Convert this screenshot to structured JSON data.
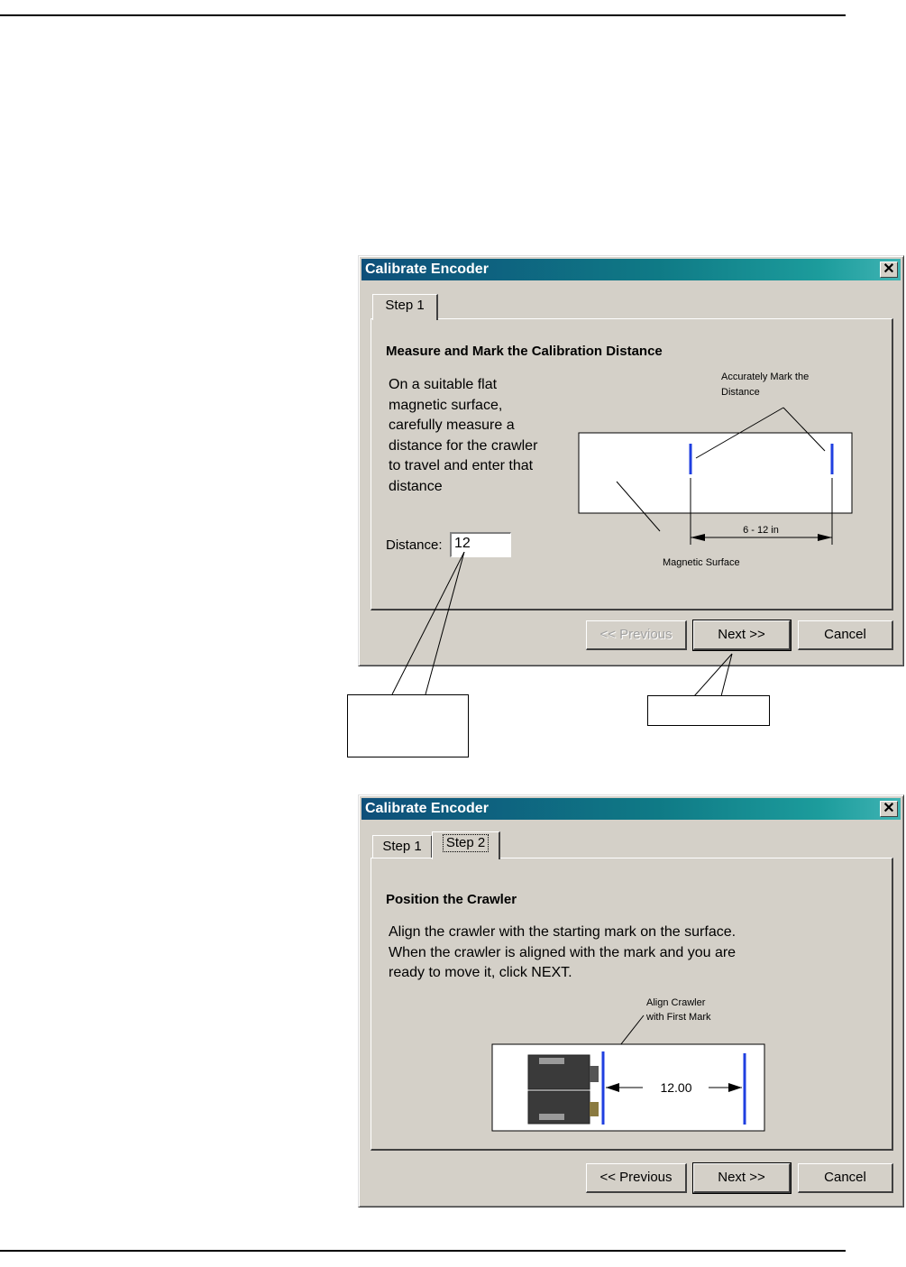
{
  "dialog1": {
    "title": "Calibrate Encoder",
    "close_glyph": "✕",
    "tabs": [
      {
        "label": "Step 1"
      }
    ],
    "heading": "Measure and Mark the Calibration Distance",
    "instructions_lines": [
      "On a suitable flat",
      "magnetic surface,",
      "carefully measure a",
      "distance for the crawler",
      "to travel and enter that",
      "distance"
    ],
    "distance_label": "Distance:",
    "distance_value": "12",
    "diagram": {
      "mark_label_line1": "Accurately Mark the",
      "mark_label_line2": "Distance",
      "range_label": "6 - 12 in",
      "surface_label": "Magnetic Surface"
    },
    "buttons": {
      "previous": "<< Previous",
      "next": "Next >>",
      "cancel": "Cancel"
    }
  },
  "dialog2": {
    "title": "Calibrate Encoder",
    "close_glyph": "✕",
    "tabs": [
      {
        "label": "Step 1"
      },
      {
        "label": "Step 2"
      }
    ],
    "heading": "Position the Crawler",
    "instructions_lines": [
      "Align the crawler with the starting mark on the surface.",
      "When the crawler is aligned with the mark and you are",
      "ready to move it, click NEXT."
    ],
    "diagram": {
      "align_label_line1": "Align Crawler",
      "align_label_line2": "with First Mark",
      "distance_value": "12.00"
    },
    "buttons": {
      "previous": "<< Previous",
      "next": "Next >>",
      "cancel": "Cancel"
    }
  },
  "colors": {
    "mark_blue": "#1f3fe0",
    "title_gradient_start": "#0e4f7a",
    "title_gradient_end": "#3fb3b3",
    "dialog_face": "#d4d0c8"
  }
}
